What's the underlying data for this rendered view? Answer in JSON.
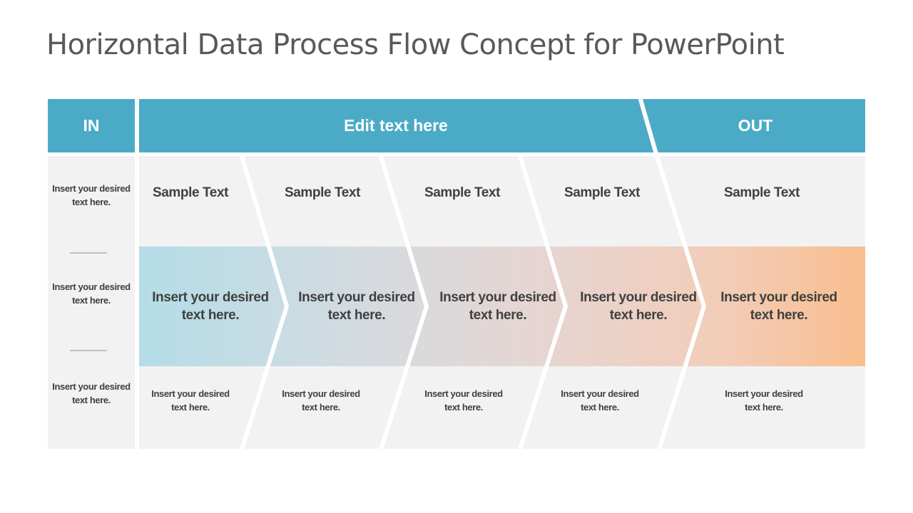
{
  "title": "Horizontal Data Process Flow Concept for PowerPoint",
  "colors": {
    "header": "#4BABC6",
    "panel": "#F2F2F2",
    "text": "#404040",
    "gradient_start": "#B4DDE8",
    "gradient_end": "#F9BE8E"
  },
  "header": {
    "in_label": "IN",
    "middle_label": "Edit text here",
    "out_label": "OUT"
  },
  "in_column": [
    "Insert your desired text here.",
    "Insert your desired text here.",
    "Insert your desired text here."
  ],
  "steps": [
    {
      "title": "Sample Text",
      "main": "Insert your desired text here.",
      "note": "Insert your desired text here."
    },
    {
      "title": "Sample Text",
      "main": "Insert your desired text here.",
      "note": "Insert your desired text here."
    },
    {
      "title": "Sample Text",
      "main": "Insert your desired text here.",
      "note": "Insert your desired text here."
    },
    {
      "title": "Sample Text",
      "main": "Insert your desired text here.",
      "note": "Insert your desired text here."
    },
    {
      "title": "Sample Text",
      "main": "Insert your desired text here.",
      "note": "Insert your desired text here."
    }
  ]
}
